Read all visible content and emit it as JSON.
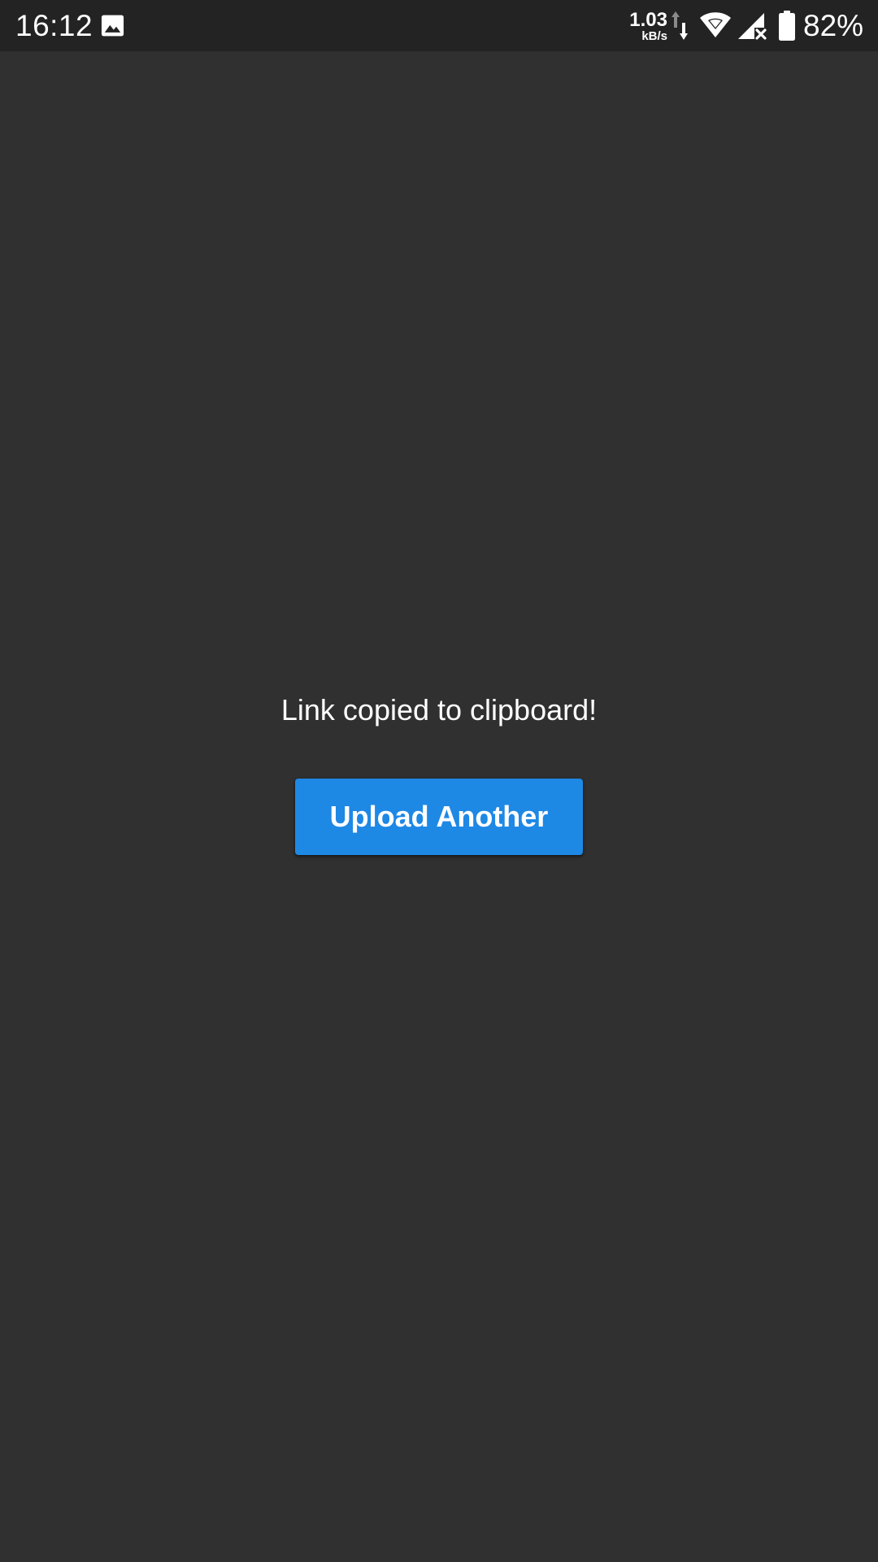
{
  "status_bar": {
    "time": "16:12",
    "network_speed_value": "1.03",
    "network_speed_unit": "kB/s",
    "battery_percent": "82%",
    "icons": [
      "image-notification-icon",
      "data-up-down-icon",
      "wifi-icon",
      "cell-signal-no-service-icon",
      "battery-icon"
    ]
  },
  "main": {
    "message": "Link copied to clipboard!",
    "button_label": "Upload Another"
  },
  "colors": {
    "background": "#303030",
    "status_bar": "#232323",
    "accent_button": "#1e88e5",
    "text": "#ffffff"
  }
}
